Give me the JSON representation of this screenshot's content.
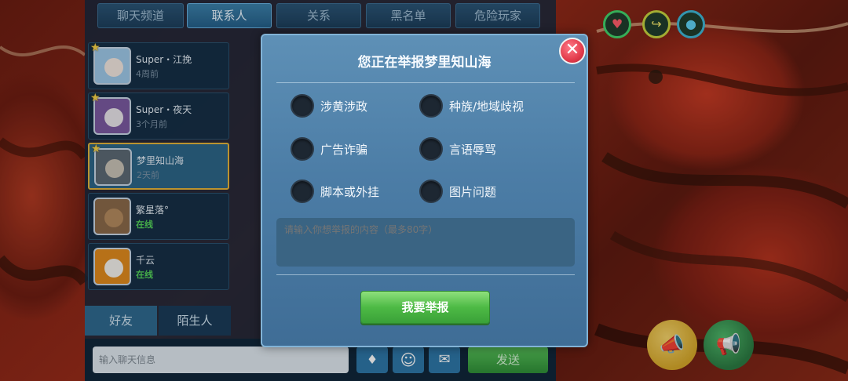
{
  "top_tabs": [
    "聊天频道",
    "联系人",
    "关系",
    "黑名单",
    "危险玩家"
  ],
  "contacts": [
    {
      "name": "Super・江挽",
      "sub": "4周前",
      "online": false
    },
    {
      "name": "Super・夜天",
      "sub": "3个月前",
      "online": false
    },
    {
      "name": "梦里知山海",
      "sub": "2天前",
      "online": false
    },
    {
      "name": "繁星落°",
      "sub": "在线",
      "online": true
    },
    {
      "name": "千云",
      "sub": "在线",
      "online": true
    }
  ],
  "bottom_tabs": {
    "friends": "好友",
    "strangers": "陌生人"
  },
  "chat_input": {
    "placeholder": "输入聊天信息"
  },
  "send_label": "发送",
  "modal": {
    "title": "您正在举报梦里知山海",
    "options": [
      "涉黄涉政",
      "种族/地域歧视",
      "广告诈骗",
      "言语辱骂",
      "脚本或外挂",
      "图片问题"
    ],
    "textarea_placeholder": "请输入你想举报的内容（最多80字）",
    "submit_label": "我要举报"
  },
  "icons": {
    "close": "close-icon",
    "heart": "heart-icon",
    "share": "share-icon",
    "water": "water-drop-icon",
    "emoji": "emoji-icon",
    "chat": "chat-bubble-icon",
    "gem": "gem-icon",
    "horn": "horn-icon"
  },
  "colors": {
    "modal_bg": "#4c7da6",
    "close_button": "#e23b4b",
    "report_button": "#4dba45",
    "online_text": "#55d35a",
    "selected_border": "#e4b43a"
  }
}
